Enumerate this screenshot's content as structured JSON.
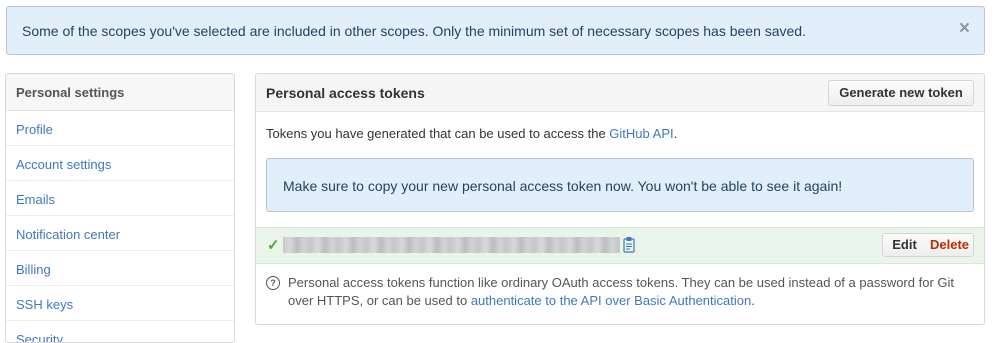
{
  "flash": {
    "message": "Some of the scopes you've selected are included in other scopes. Only the minimum set of necessary scopes has been saved.",
    "close_glyph": "×"
  },
  "sidebar": {
    "heading": "Personal settings",
    "items": [
      {
        "label": "Profile"
      },
      {
        "label": "Account settings"
      },
      {
        "label": "Emails"
      },
      {
        "label": "Notification center"
      },
      {
        "label": "Billing"
      },
      {
        "label": "SSH keys"
      },
      {
        "label": "Security"
      }
    ]
  },
  "tokens": {
    "title": "Personal access tokens",
    "generate_label": "Generate new token",
    "intro_prefix": "Tokens you have generated that can be used to access the ",
    "intro_link": "GitHub API",
    "intro_suffix": ".",
    "notice": "Make sure to copy your new personal access token now. You won't be able to see it again!",
    "token": {
      "check_glyph": "✓",
      "value": "",
      "edit_label": "Edit",
      "delete_label": "Delete"
    },
    "help": {
      "icon_glyph": "?",
      "text_prefix": "Personal access tokens function like ordinary OAuth access tokens. They can be used instead of a password for Git over HTTPS, or can be used to ",
      "link": "authenticate to the API over Basic Authentication",
      "text_suffix": "."
    }
  },
  "colors": {
    "accent_link": "#4078c0",
    "danger": "#bd2c00",
    "success": "#55a532",
    "flash_bg": "#e2eef9"
  },
  "icons": [
    "close-icon",
    "check-icon",
    "clipboard-icon",
    "question-icon"
  ]
}
